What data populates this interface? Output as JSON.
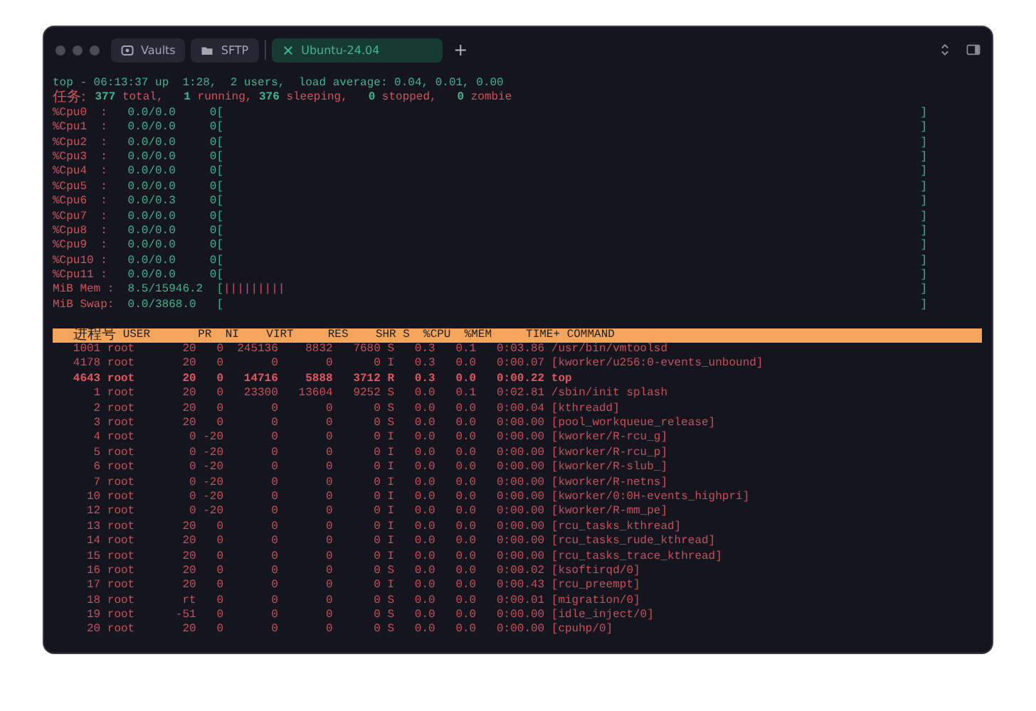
{
  "tabs": [
    {
      "label": "Vaults",
      "kind": "vault",
      "selected": false
    },
    {
      "label": "SFTP",
      "kind": "folder",
      "selected": false
    },
    {
      "label": "Ubuntu-24.04",
      "kind": "session",
      "selected": true
    }
  ],
  "new_tab": "+",
  "terminal": {
    "status_line": "top - 06:13:37 up  1:28,  2 users,  load average: 0.04, 0.01, 0.00",
    "tasks": [
      {
        "text": "任务:",
        "kind": "cjk"
      },
      {
        "text": "377",
        "kind": "value"
      },
      {
        "text": " total,   ",
        "kind": "label"
      },
      {
        "text": "1",
        "kind": "value"
      },
      {
        "text": " running, ",
        "kind": "label"
      },
      {
        "text": "376",
        "kind": "value"
      },
      {
        "text": " sleeping,   ",
        "kind": "label"
      },
      {
        "text": "0",
        "kind": "value"
      },
      {
        "text": " stopped,   ",
        "kind": "label"
      },
      {
        "text": "0",
        "kind": "value"
      },
      {
        "text": " zombie",
        "kind": "label"
      }
    ],
    "meters": [
      {
        "label": "%Cpu0  :",
        "value": "0.0/0.0",
        "open": "0[",
        "close": "]"
      },
      {
        "label": "%Cpu1  :",
        "value": "0.0/0.0",
        "open": "0[",
        "close": "]"
      },
      {
        "label": "%Cpu2  :",
        "value": "0.0/0.0",
        "open": "0[",
        "close": "]"
      },
      {
        "label": "%Cpu3  :",
        "value": "0.0/0.0",
        "open": "0[",
        "close": "]"
      },
      {
        "label": "%Cpu4  :",
        "value": "0.0/0.0",
        "open": "0[",
        "close": "]"
      },
      {
        "label": "%Cpu5  :",
        "value": "0.0/0.0",
        "open": "0[",
        "close": "]"
      },
      {
        "label": "%Cpu6  :",
        "value": "0.0/0.3",
        "open": "0[",
        "close": "]"
      },
      {
        "label": "%Cpu7  :",
        "value": "0.0/0.0",
        "open": "0[",
        "close": "]"
      },
      {
        "label": "%Cpu8  :",
        "value": "0.0/0.0",
        "open": "0[",
        "close": "]"
      },
      {
        "label": "%Cpu9  :",
        "value": "0.0/0.0",
        "open": "0[",
        "close": "]"
      },
      {
        "label": "%Cpu10 :",
        "value": "0.0/0.0",
        "open": "0[",
        "close": "]"
      },
      {
        "label": "%Cpu11 :",
        "value": "0.0/0.0",
        "open": "0[",
        "close": "]"
      },
      {
        "label": "MiB Mem :",
        "value": "8.5/15946.2",
        "open": "[",
        "bar": "|||||||||",
        "close": "]"
      },
      {
        "label": "MiB Swap:",
        "value": "0.0/3868.0",
        "open": "[",
        "close": "]"
      }
    ],
    "table": {
      "columns": [
        "进程号",
        "USER",
        "PR",
        "NI",
        "VIRT",
        "RES",
        "SHR",
        "S",
        "%CPU",
        "%MEM",
        "TIME+",
        "COMMAND"
      ],
      "rows": [
        {
          "bold": false,
          "cells": [
            "1001",
            "root",
            "20",
            "0",
            "245136",
            "8832",
            "7680",
            "S",
            "0.3",
            "0.1",
            "0:03.86",
            "/usr/bin/vmtoolsd"
          ]
        },
        {
          "bold": false,
          "cells": [
            "4178",
            "root",
            "20",
            "0",
            "0",
            "0",
            "0",
            "I",
            "0.3",
            "0.0",
            "0:00.07",
            "[kworker/u256:0-events_unbound]"
          ]
        },
        {
          "bold": true,
          "cells": [
            "4643",
            "root",
            "20",
            "0",
            "14716",
            "5888",
            "3712",
            "R",
            "0.3",
            "0.0",
            "0:00.22",
            "top"
          ]
        },
        {
          "bold": false,
          "cells": [
            "1",
            "root",
            "20",
            "0",
            "23300",
            "13604",
            "9252",
            "S",
            "0.0",
            "0.1",
            "0:02.81",
            "/sbin/init splash"
          ]
        },
        {
          "bold": false,
          "cells": [
            "2",
            "root",
            "20",
            "0",
            "0",
            "0",
            "0",
            "S",
            "0.0",
            "0.0",
            "0:00.04",
            "[kthreadd]"
          ]
        },
        {
          "bold": false,
          "cells": [
            "3",
            "root",
            "20",
            "0",
            "0",
            "0",
            "0",
            "S",
            "0.0",
            "0.0",
            "0:00.00",
            "[pool_workqueue_release]"
          ]
        },
        {
          "bold": false,
          "cells": [
            "4",
            "root",
            "0",
            "-20",
            "0",
            "0",
            "0",
            "I",
            "0.0",
            "0.0",
            "0:00.00",
            "[kworker/R-rcu_g]"
          ]
        },
        {
          "bold": false,
          "cells": [
            "5",
            "root",
            "0",
            "-20",
            "0",
            "0",
            "0",
            "I",
            "0.0",
            "0.0",
            "0:00.00",
            "[kworker/R-rcu_p]"
          ]
        },
        {
          "bold": false,
          "cells": [
            "6",
            "root",
            "0",
            "-20",
            "0",
            "0",
            "0",
            "I",
            "0.0",
            "0.0",
            "0:00.00",
            "[kworker/R-slub_]"
          ]
        },
        {
          "bold": false,
          "cells": [
            "7",
            "root",
            "0",
            "-20",
            "0",
            "0",
            "0",
            "I",
            "0.0",
            "0.0",
            "0:00.00",
            "[kworker/R-netns]"
          ]
        },
        {
          "bold": false,
          "cells": [
            "10",
            "root",
            "0",
            "-20",
            "0",
            "0",
            "0",
            "I",
            "0.0",
            "0.0",
            "0:00.00",
            "[kworker/0:0H-events_highpri]"
          ]
        },
        {
          "bold": false,
          "cells": [
            "12",
            "root",
            "0",
            "-20",
            "0",
            "0",
            "0",
            "I",
            "0.0",
            "0.0",
            "0:00.00",
            "[kworker/R-mm_pe]"
          ]
        },
        {
          "bold": false,
          "cells": [
            "13",
            "root",
            "20",
            "0",
            "0",
            "0",
            "0",
            "I",
            "0.0",
            "0.0",
            "0:00.00",
            "[rcu_tasks_kthread]"
          ]
        },
        {
          "bold": false,
          "cells": [
            "14",
            "root",
            "20",
            "0",
            "0",
            "0",
            "0",
            "I",
            "0.0",
            "0.0",
            "0:00.00",
            "[rcu_tasks_rude_kthread]"
          ]
        },
        {
          "bold": false,
          "cells": [
            "15",
            "root",
            "20",
            "0",
            "0",
            "0",
            "0",
            "I",
            "0.0",
            "0.0",
            "0:00.00",
            "[rcu_tasks_trace_kthread]"
          ]
        },
        {
          "bold": false,
          "cells": [
            "16",
            "root",
            "20",
            "0",
            "0",
            "0",
            "0",
            "S",
            "0.0",
            "0.0",
            "0:00.02",
            "[ksoftirqd/0]"
          ]
        },
        {
          "bold": false,
          "cells": [
            "17",
            "root",
            "20",
            "0",
            "0",
            "0",
            "0",
            "I",
            "0.0",
            "0.0",
            "0:00.43",
            "[rcu_preempt]"
          ]
        },
        {
          "bold": false,
          "cells": [
            "18",
            "root",
            "rt",
            "0",
            "0",
            "0",
            "0",
            "S",
            "0.0",
            "0.0",
            "0:00.01",
            "[migration/0]"
          ]
        },
        {
          "bold": false,
          "cells": [
            "19",
            "root",
            "-51",
            "0",
            "0",
            "0",
            "0",
            "S",
            "0.0",
            "0.0",
            "0:00.00",
            "[idle_inject/0]"
          ]
        },
        {
          "bold": false,
          "cells": [
            "20",
            "root",
            "20",
            "0",
            "0",
            "0",
            "0",
            "S",
            "0.0",
            "0.0",
            "0:00.00",
            "[cpuhp/0]"
          ]
        }
      ]
    }
  }
}
